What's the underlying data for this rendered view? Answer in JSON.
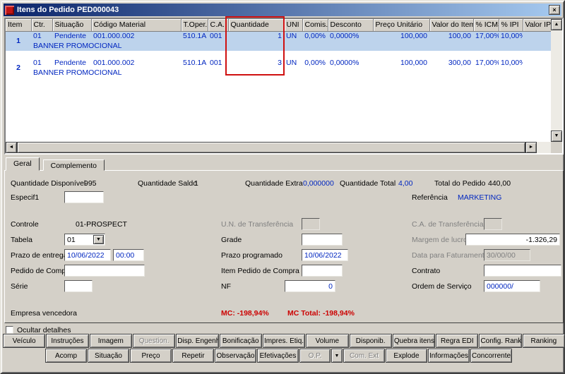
{
  "colors": {
    "titlebar_left": "#0a246a",
    "titlebar_right": "#a6caf0",
    "selected_row": "#bdd3ec",
    "data_blue": "#0026c0",
    "disabled_gray": "#808080",
    "negative_red": "#cc0000",
    "annotation_red": "#cf1010"
  },
  "icons": {
    "close": "×",
    "scroll_up": "▲",
    "scroll_down": "▼",
    "scroll_left": "◄",
    "scroll_right": "►",
    "combo_arrow": "▼",
    "op_dropdown": "▼"
  },
  "window": {
    "title": "Itens do Pedido PED000043"
  },
  "grid": {
    "columns": [
      "Item",
      "Ctr.",
      "Situação",
      "Código Material",
      "T.Oper.",
      "C.A.",
      "Quantidade",
      "UNI",
      "Comis.",
      "Desconto",
      "Preço Unitário",
      "Valor do Item",
      "% ICMS",
      "% IPI",
      "Valor IPI"
    ],
    "rows": [
      {
        "item": "1",
        "ctr": "01",
        "situacao": "Pendente",
        "codigo_material": "001.000.002",
        "t_oper": "510.1A",
        "ca": "001",
        "quantidade": "1",
        "uni": "UN",
        "comis": "0,00%",
        "desconto": "0,0000%",
        "preco_unitario": "100,000",
        "valor_do_item": "100,00",
        "icms": "17,00%",
        "ipi": "10,00%",
        "valor_ipi": "",
        "descricao": "BANNER PROMOCIONAL"
      },
      {
        "item": "2",
        "ctr": "01",
        "situacao": "Pendente",
        "codigo_material": "001.000.002",
        "t_oper": "510.1A",
        "ca": "001",
        "quantidade": "3",
        "uni": "UN",
        "comis": "0,00%",
        "desconto": "0,0000%",
        "preco_unitario": "100,000",
        "valor_do_item": "300,00",
        "icms": "17,00%",
        "ipi": "10,00%",
        "valor_ipi": "",
        "descricao": "BANNER PROMOCIONAL"
      }
    ]
  },
  "tabs": {
    "geral": "Geral",
    "complemento": "Complemento"
  },
  "summary": {
    "quantidade_disponivel_label": "Quantidade Disponível",
    "quantidade_disponivel": "995",
    "quantidade_saldo_label": "Quantidade Saldo",
    "quantidade_saldo": "1",
    "quantidade_extra_label": "Quantidade Extra",
    "quantidade_extra": "0,000000",
    "quantidade_total_label": "Quantidade Total",
    "quantidade_total": "4,00",
    "total_do_pedido_label": "Total do Pedido",
    "total_do_pedido": "440,00"
  },
  "form": {
    "especif1_label": "Especif1",
    "especif1": "",
    "referencia_label": "Referência",
    "referencia": "MARKETING",
    "controle_label": "Controle",
    "controle": "01-PROSPECT",
    "un_transferencia_label": "U.N. de Transferência",
    "un_transferencia": "",
    "ca_transferencia_label": "C.A. de Transferência",
    "ca_transferencia": "",
    "tabela_label": "Tabela",
    "tabela": "01",
    "grade_label": "Grade",
    "grade": "",
    "margem_lucro_label": "Margem de lucro",
    "margem_lucro": "-1.326,29",
    "prazo_entrega_label": "Prazo de entrega",
    "prazo_entrega_data": "10/06/2022",
    "prazo_entrega_hora": "00:00",
    "prazo_programado_label": "Prazo programado",
    "prazo_programado": "10/06/2022",
    "data_faturamento_label": "Data para Faturamento",
    "data_faturamento": "30/00/00",
    "pedido_compra_label": "Pedido de Compra",
    "pedido_compra": "",
    "item_pedido_compra_label": "Item Pedido de Compra",
    "item_pedido_compra": "",
    "contrato_label": "Contrato",
    "contrato": "",
    "serie_label": "Série",
    "serie": "",
    "nf_label": "NF",
    "nf": "0",
    "ordem_servico_label": "Ordem de Serviço",
    "ordem_servico": "000000/",
    "empresa_vencedora_label": "Empresa vencedora",
    "mc": "MC: -198,94%",
    "mc_total": "MC Total: -198,94%"
  },
  "footer": {
    "ocultar_detalhes_label": "Ocultar detalhes",
    "buttons_row1": [
      {
        "label": "Veículo",
        "enabled": true
      },
      {
        "label": "Instruções",
        "enabled": true
      },
      {
        "label": "Imagem",
        "enabled": true
      },
      {
        "label": "Question.",
        "enabled": false
      },
      {
        "label": "Disp. Engenh.",
        "enabled": true
      },
      {
        "label": "Bonificação",
        "enabled": true
      },
      {
        "label": "Impres. Etiq.",
        "enabled": true
      },
      {
        "label": "Volume",
        "enabled": true
      },
      {
        "label": "Disponib.",
        "enabled": true
      },
      {
        "label": "Quebra itens",
        "enabled": true
      },
      {
        "label": "Regra EDI",
        "enabled": true
      },
      {
        "label": "Config. Rank.",
        "enabled": true
      },
      {
        "label": "Ranking",
        "enabled": true
      }
    ],
    "buttons_row2": [
      {
        "label": "Acomp",
        "enabled": true
      },
      {
        "label": "Situação",
        "enabled": true
      },
      {
        "label": "Preço",
        "enabled": true
      },
      {
        "label": "Repetir",
        "enabled": true
      },
      {
        "label": "Observação",
        "enabled": true
      },
      {
        "label": "Efetivações",
        "enabled": true
      },
      {
        "label": "O.P.",
        "enabled": false
      },
      {
        "label": "Com. Ext",
        "enabled": false
      },
      {
        "label": "Explode",
        "enabled": true
      },
      {
        "label": "Informações",
        "enabled": true
      },
      {
        "label": "Concorrente",
        "enabled": true
      }
    ]
  }
}
